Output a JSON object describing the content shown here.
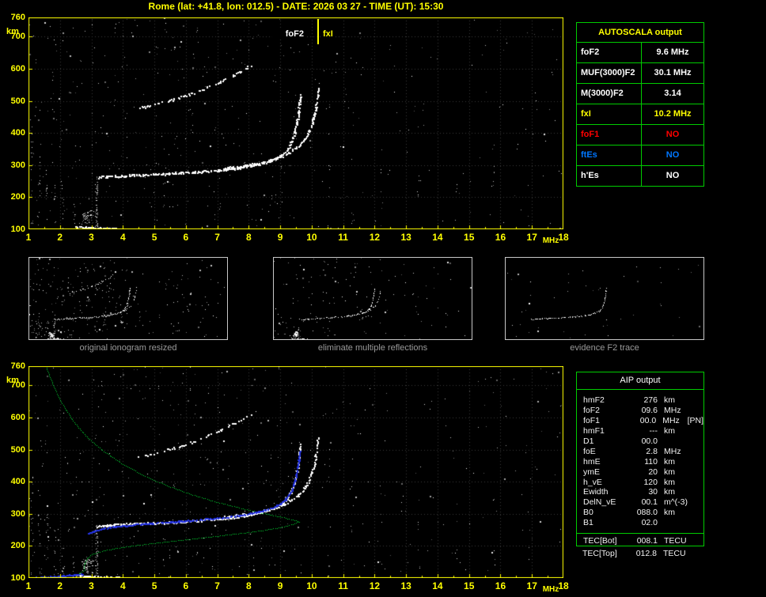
{
  "title": "Rome (lat: +41.8, lon: 012.5) - DATE: 2026 03 27 - TIME (UT): 15:30",
  "colors": {
    "accent_yellow": "#ffff00",
    "table_green": "#00cc00",
    "status_red": "#ff0000",
    "status_blue": "#0077ff",
    "trace_white": "#ffffff",
    "trace_blue": "#2433e0",
    "profile_green": "#00dd33",
    "grid_gray": "#3a3a3a",
    "caption_gray": "#9a9a9a"
  },
  "axes": {
    "y_ticks": [
      "760",
      "700",
      "600",
      "500",
      "400",
      "300",
      "200",
      "100"
    ],
    "y_unit": "km",
    "x_ticks": [
      "1",
      "2",
      "3",
      "4",
      "5",
      "6",
      "7",
      "8",
      "9",
      "10",
      "11",
      "12",
      "13",
      "14",
      "15",
      "16",
      "17",
      "18"
    ],
    "x_unit": "MHz"
  },
  "top_plot": {
    "foF2_label": "foF2",
    "fxI_label": "fxI"
  },
  "thumbnails": [
    {
      "caption": "original ionogram resized"
    },
    {
      "caption": "eliminate multiple reflections"
    },
    {
      "caption": "evidence F2 trace"
    }
  ],
  "autoscala": {
    "title": "AUTOSCALA output",
    "rows": [
      {
        "label": "foF2",
        "value": "9.6 MHz",
        "color": "#ffffff"
      },
      {
        "label": "MUF(3000)F2",
        "value": "30.1 MHz",
        "color": "#ffffff"
      },
      {
        "label": "M(3000)F2",
        "value": "3.14",
        "color": "#ffffff"
      },
      {
        "label": "fxI",
        "value": "10.2 MHz",
        "color": "#ffff00"
      },
      {
        "label": "foF1",
        "value": "NO",
        "color": "#ff0000"
      },
      {
        "label": "ftEs",
        "value": "NO",
        "color": "#0077ff"
      },
      {
        "label": "h'Es",
        "value": "NO",
        "color": "#ffffff"
      }
    ]
  },
  "aip": {
    "title": "AIP output",
    "rows": [
      {
        "label": "hmF2",
        "value": "276",
        "unit": "km",
        "note": ""
      },
      {
        "label": "foF2",
        "value": "09.6",
        "unit": "MHz",
        "note": ""
      },
      {
        "label": "foF1",
        "value": "00.0",
        "unit": "MHz",
        "note": "[PN]"
      },
      {
        "label": "hmF1",
        "value": "---",
        "unit": "km",
        "note": ""
      },
      {
        "label": "D1",
        "value": "00.0",
        "unit": "",
        "note": ""
      },
      {
        "label": "foE",
        "value": "2.8",
        "unit": "MHz",
        "note": ""
      },
      {
        "label": "hmE",
        "value": "110",
        "unit": "km",
        "note": ""
      },
      {
        "label": "ymE",
        "value": "20",
        "unit": "km",
        "note": ""
      },
      {
        "label": "h_vE",
        "value": "120",
        "unit": "km",
        "note": ""
      },
      {
        "label": "Ewidth",
        "value": "30",
        "unit": "km",
        "note": ""
      },
      {
        "label": "DelN_vE",
        "value": "00.1",
        "unit": "m^(-3)",
        "note": ""
      },
      {
        "label": "B0",
        "value": "088.0",
        "unit": "km",
        "note": ""
      },
      {
        "label": "B1",
        "value": "02.0",
        "unit": "",
        "note": ""
      }
    ],
    "tec_rows": [
      {
        "label": "TEC[Bot]",
        "value": "008.1",
        "unit": "TECU"
      },
      {
        "label": "TEC[Top]",
        "value": "012.8",
        "unit": "TECU"
      }
    ]
  },
  "chart_data": {
    "type": "scatter",
    "title": "Ionogram with AUTOSCALA / AIP interpretation, Rome, 2026-03-27 15:30 UT",
    "xlabel": "MHz",
    "ylabel": "km",
    "xlim": [
      1,
      18
    ],
    "ylim": [
      100,
      760
    ],
    "grid": true,
    "scaled_values": {
      "foF2_MHz": 9.6,
      "fxI_MHz": 10.2,
      "hmF2_km": 276
    },
    "traces": {
      "f2_ordinary": [
        [
          3.2,
          263
        ],
        [
          3.5,
          265
        ],
        [
          4.0,
          268
        ],
        [
          4.5,
          270
        ],
        [
          5.0,
          273
        ],
        [
          5.5,
          275
        ],
        [
          6.0,
          278
        ],
        [
          6.5,
          281
        ],
        [
          7.0,
          285
        ],
        [
          7.5,
          290
        ],
        [
          7.9,
          296
        ],
        [
          8.3,
          304
        ],
        [
          8.7,
          315
        ],
        [
          9.0,
          330
        ],
        [
          9.2,
          348
        ],
        [
          9.35,
          372
        ],
        [
          9.45,
          400
        ],
        [
          9.52,
          432
        ],
        [
          9.57,
          464
        ],
        [
          9.6,
          495
        ],
        [
          9.62,
          518
        ]
      ],
      "f2_extraordinary": [
        [
          7.2,
          291
        ],
        [
          7.7,
          297
        ],
        [
          8.2,
          305
        ],
        [
          8.6,
          314
        ],
        [
          9.0,
          326
        ],
        [
          9.3,
          341
        ],
        [
          9.6,
          362
        ],
        [
          9.8,
          388
        ],
        [
          9.95,
          418
        ],
        [
          10.05,
          450
        ],
        [
          10.12,
          482
        ],
        [
          10.17,
          512
        ],
        [
          10.2,
          540
        ]
      ],
      "second_hop": [
        [
          4.5,
          478
        ],
        [
          5.0,
          490
        ],
        [
          5.5,
          503
        ],
        [
          6.0,
          518
        ],
        [
          6.5,
          536
        ],
        [
          7.0,
          556
        ],
        [
          7.4,
          576
        ],
        [
          7.8,
          597
        ],
        [
          8.05,
          612
        ]
      ],
      "sporadic_e": [
        [
          2.5,
          110
        ],
        [
          2.8,
          107
        ],
        [
          3.1,
          105
        ],
        [
          3.5,
          104
        ],
        [
          3.9,
          104
        ]
      ]
    },
    "e_region_cluster": {
      "f": 2.85,
      "km": 140,
      "sf": 0.3,
      "skm": 38,
      "n": 48
    },
    "noise_columns": [
      {
        "f": 1.12,
        "top": 420,
        "n": 18
      },
      {
        "f": 1.35,
        "top": 380,
        "n": 14
      },
      {
        "f": 1.6,
        "top": 300,
        "n": 12
      },
      {
        "f": 1.85,
        "top": 260,
        "n": 10
      },
      {
        "f": 2.1,
        "top": 240,
        "n": 10
      },
      {
        "f": 2.45,
        "top": 200,
        "n": 8
      },
      {
        "f": 3.17,
        "top": 265,
        "n": 60
      },
      {
        "f": 5.3,
        "top": 460,
        "n": 6
      },
      {
        "f": 6.1,
        "top": 520,
        "n": 5
      },
      {
        "f": 10.55,
        "top": 520,
        "n": 9
      },
      {
        "f": 11.3,
        "top": 480,
        "n": 6
      },
      {
        "f": 12.2,
        "top": 430,
        "n": 6
      },
      {
        "f": 13.4,
        "top": 400,
        "n": 5
      },
      {
        "f": 14.6,
        "top": 430,
        "n": 5
      },
      {
        "f": 15.8,
        "top": 380,
        "n": 5
      },
      {
        "f": 16.9,
        "top": 350,
        "n": 4
      }
    ],
    "fitted_trace_blue": [
      [
        2.9,
        240
      ],
      [
        3.1,
        248
      ],
      [
        3.4,
        256
      ],
      [
        3.8,
        262
      ],
      [
        4.3,
        267
      ],
      [
        4.9,
        272
      ],
      [
        5.5,
        276
      ],
      [
        6.1,
        280
      ],
      [
        6.7,
        285
      ],
      [
        7.3,
        291
      ],
      [
        7.8,
        298
      ],
      [
        8.3,
        307
      ],
      [
        8.7,
        318
      ],
      [
        9.0,
        333
      ],
      [
        9.2,
        351
      ],
      [
        9.35,
        375
      ],
      [
        9.45,
        403
      ],
      [
        9.52,
        434
      ],
      [
        9.57,
        466
      ],
      [
        9.6,
        497
      ]
    ],
    "fitted_e_trace_blue": [
      [
        1.0,
        101
      ],
      [
        1.35,
        103
      ],
      [
        1.7,
        105
      ],
      [
        2.1,
        108
      ],
      [
        2.45,
        111
      ],
      [
        2.7,
        114
      ]
    ],
    "density_profile_green": {
      "topside": [
        [
          1.55,
          760
        ],
        [
          1.7,
          720
        ],
        [
          1.9,
          675
        ],
        [
          2.15,
          630
        ],
        [
          2.45,
          585
        ],
        [
          2.85,
          540
        ],
        [
          3.35,
          498
        ],
        [
          3.95,
          458
        ],
        [
          4.6,
          423
        ],
        [
          5.3,
          392
        ],
        [
          6.1,
          363
        ],
        [
          6.9,
          339
        ],
        [
          7.7,
          319
        ],
        [
          8.4,
          303
        ],
        [
          9.0,
          291
        ],
        [
          9.4,
          282
        ],
        [
          9.6,
          276
        ]
      ],
      "bottomside": [
        [
          9.6,
          276
        ],
        [
          9.4,
          268
        ],
        [
          9.0,
          258
        ],
        [
          8.4,
          248
        ],
        [
          7.6,
          238
        ],
        [
          6.7,
          228
        ],
        [
          5.8,
          218
        ],
        [
          4.9,
          208
        ],
        [
          4.1,
          198
        ],
        [
          3.5,
          188
        ],
        [
          3.05,
          176
        ],
        [
          2.85,
          162
        ],
        [
          2.78,
          148
        ],
        [
          2.76,
          135
        ],
        [
          2.78,
          124
        ],
        [
          2.6,
          114
        ],
        [
          2.2,
          107
        ],
        [
          1.8,
          103
        ],
        [
          1.4,
          101
        ],
        [
          1.1,
          100
        ]
      ]
    }
  }
}
